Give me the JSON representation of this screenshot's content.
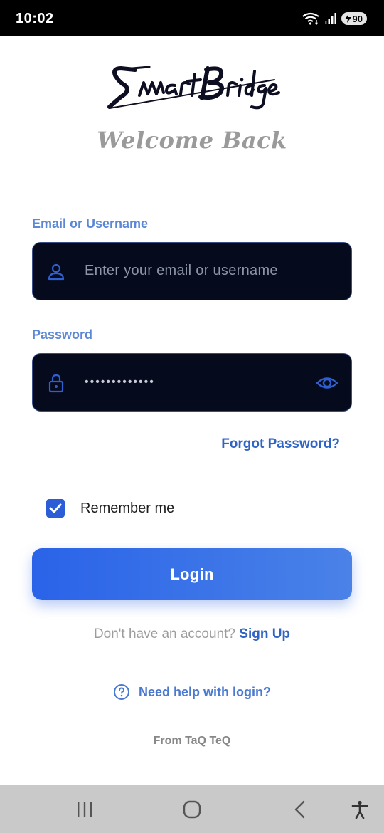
{
  "status_bar": {
    "time": "10:02",
    "battery_level": "90",
    "icons": [
      "wifi-icon",
      "signal-icon",
      "battery-icon"
    ]
  },
  "brand": {
    "logo_text": "SmartBridge",
    "welcome": "Welcome Back"
  },
  "form": {
    "email_label": "Email or Username",
    "email_placeholder": "Enter your email or username",
    "password_label": "Password",
    "password_value": "•••••••••••••",
    "forgot_label": "Forgot Password?",
    "remember_label": "Remember me",
    "remember_checked": true,
    "login_label": "Login"
  },
  "signup": {
    "question": "Don't have an account?",
    "link": "Sign Up"
  },
  "help": {
    "label": "Need help with login?"
  },
  "footer": {
    "text": "From TaQ TeQ"
  },
  "colors": {
    "accent": "#2b5ed6",
    "label": "#5b87d6",
    "input_bg": "#050a1c",
    "link": "#2f63c4"
  },
  "nav_bar": {
    "icons": [
      "recent-apps-icon",
      "home-icon",
      "back-icon",
      "accessibility-icon"
    ]
  }
}
